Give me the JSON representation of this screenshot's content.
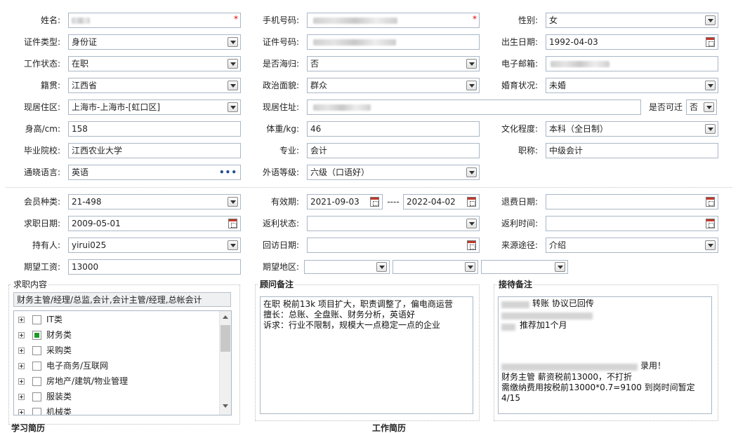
{
  "form": {
    "required_mark": "*",
    "name_label": "姓名:",
    "phone_label": "手机号码:",
    "gender_label": "性别:",
    "gender_value": "女",
    "id_type_label": "证件类型:",
    "id_type_value": "身份证",
    "id_number_label": "证件号码:",
    "birth_label": "出生日期:",
    "birth_value": "1992-04-03",
    "work_status_label": "工作状态:",
    "work_status_value": "在职",
    "overseas_label": "是否海归:",
    "overseas_value": "否",
    "email_label": "电子邮箱:",
    "native_label": "籍贯:",
    "native_value": "江西省",
    "political_label": "政治面貌:",
    "political_value": "群众",
    "marital_label": "婚育状况:",
    "marital_value": "未婚",
    "residence_area_label": "现居住区:",
    "residence_area_value": "上海市-上海市-[虹口区]",
    "address_label": "现居住址:",
    "relocate_label": "是否可迁",
    "relocate_value": "否",
    "height_label": "身高/cm:",
    "height_value": "158",
    "weight_label": "体重/kg:",
    "weight_value": "46",
    "education_label": "文化程度:",
    "education_value": "本科（全日制）",
    "school_label": "毕业院校:",
    "school_value": "江西农业大学",
    "major_label": "专业:",
    "major_value": "会计",
    "title_label": "职称:",
    "title_value": "中级会计",
    "language_label": "通晓语言:",
    "language_value": "英语",
    "language_more": "•••",
    "foreign_level_label": "外语等级:",
    "foreign_level_value": "六级（口语好）"
  },
  "membership": {
    "member_type_label": "会员种类:",
    "member_type_value": "21-498",
    "validity_label": "有效期:",
    "validity_from": "2021-09-03",
    "validity_sep": "----",
    "validity_to": "2022-04-02",
    "refund_date_label": "退费日期:",
    "job_date_label": "求职日期:",
    "job_date_value": "2009-05-01",
    "rebate_status_label": "返利状态:",
    "rebate_time_label": "返利时间:",
    "holder_label": "持有人:",
    "holder_value": "yirui025",
    "visit_date_label": "回访日期:",
    "source_label": "来源途径:",
    "source_value": "介绍",
    "salary_label": "期望工资:",
    "salary_value": "13000",
    "region_label": "期望地区:"
  },
  "job_content": {
    "title": "求职内容",
    "summary": "财务主管/经理/总监,会计,会计主管/经理,总帐会计",
    "tree": [
      {
        "label": "IT类",
        "checked": false
      },
      {
        "label": "财务类",
        "checked": true
      },
      {
        "label": "采购类",
        "checked": false
      },
      {
        "label": "电子商务/互联网",
        "checked": false
      },
      {
        "label": "房地产/建筑/物业管理",
        "checked": false
      },
      {
        "label": "服装类",
        "checked": false
      },
      {
        "label": "机械类",
        "checked": false
      }
    ]
  },
  "consultant_notes": {
    "title": "顾问备注",
    "lines": [
      "在职 税前13k 项目扩大，职责调整了，偏电商运营",
      "擅长：总账、全盘账、财务分析，英语好",
      "诉求：行业不限制，规模大一点稳定一点的企业"
    ]
  },
  "reception_notes": {
    "title": "接待备注",
    "line1": "转账 协议已回传",
    "line2": "推荐加1个月",
    "line3": "录用！",
    "line4": "财务主管 薪资税前13000，不打折",
    "line5": "需缴纳费用按税前13000*0.7=9100  到岗时间暂定4/15"
  },
  "footer": {
    "left_cut": "学习简历",
    "right_cut": "工作简历"
  }
}
